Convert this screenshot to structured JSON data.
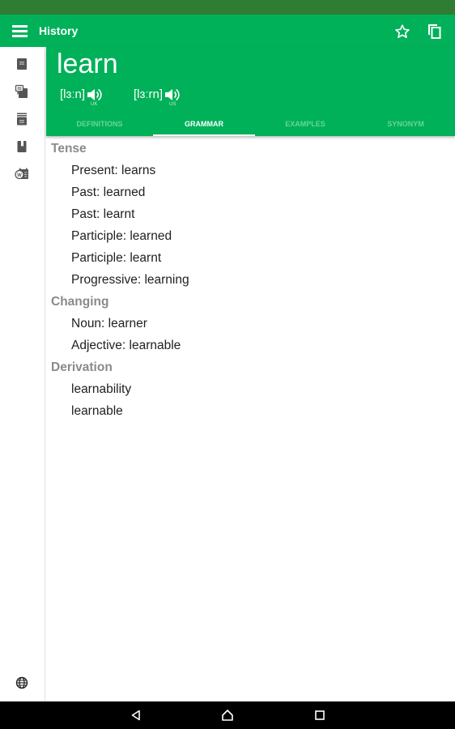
{
  "appbar": {
    "title": "History",
    "icons": [
      "menu-icon",
      "star-icon",
      "copy-icon"
    ]
  },
  "sidebar": {
    "items": [
      {
        "icon": "dictionary-icon"
      },
      {
        "icon": "comments-book-icon"
      },
      {
        "icon": "archive-icon"
      },
      {
        "icon": "bookmark-book-icon"
      },
      {
        "icon": "word-of-the-day-icon"
      }
    ],
    "footer_icon": "globe-icon"
  },
  "entry": {
    "word": "learn",
    "pronunciations": [
      {
        "ipa": "[lɜːn]",
        "region": "UK"
      },
      {
        "ipa": "[lɜːrn]",
        "region": "US"
      }
    ]
  },
  "tabs": [
    {
      "label": "DEFINITIONS",
      "active": false
    },
    {
      "label": "GRAMMAR",
      "active": true
    },
    {
      "label": "EXAMPLES",
      "active": false
    },
    {
      "label": "SYNONYM",
      "active": false
    }
  ],
  "grammar": {
    "sections": [
      {
        "title": "Tense",
        "items": [
          "Present: learns",
          "Past: learned",
          "Past: learnt",
          "Participle: learned",
          "Participle: learnt",
          "Progressive: learning"
        ]
      },
      {
        "title": "Changing",
        "items": [
          "Noun: learner",
          "Adjective: learnable"
        ]
      },
      {
        "title": "Derivation",
        "items": [
          "learnability",
          "learnable"
        ]
      }
    ]
  },
  "navbar": {
    "buttons": [
      "back",
      "home",
      "recents"
    ]
  },
  "colors": {
    "primary": "#00b159",
    "status_bar": "#2e7d32",
    "section_title": "#8a8a8a",
    "inactive_tab": "#66d69b"
  }
}
